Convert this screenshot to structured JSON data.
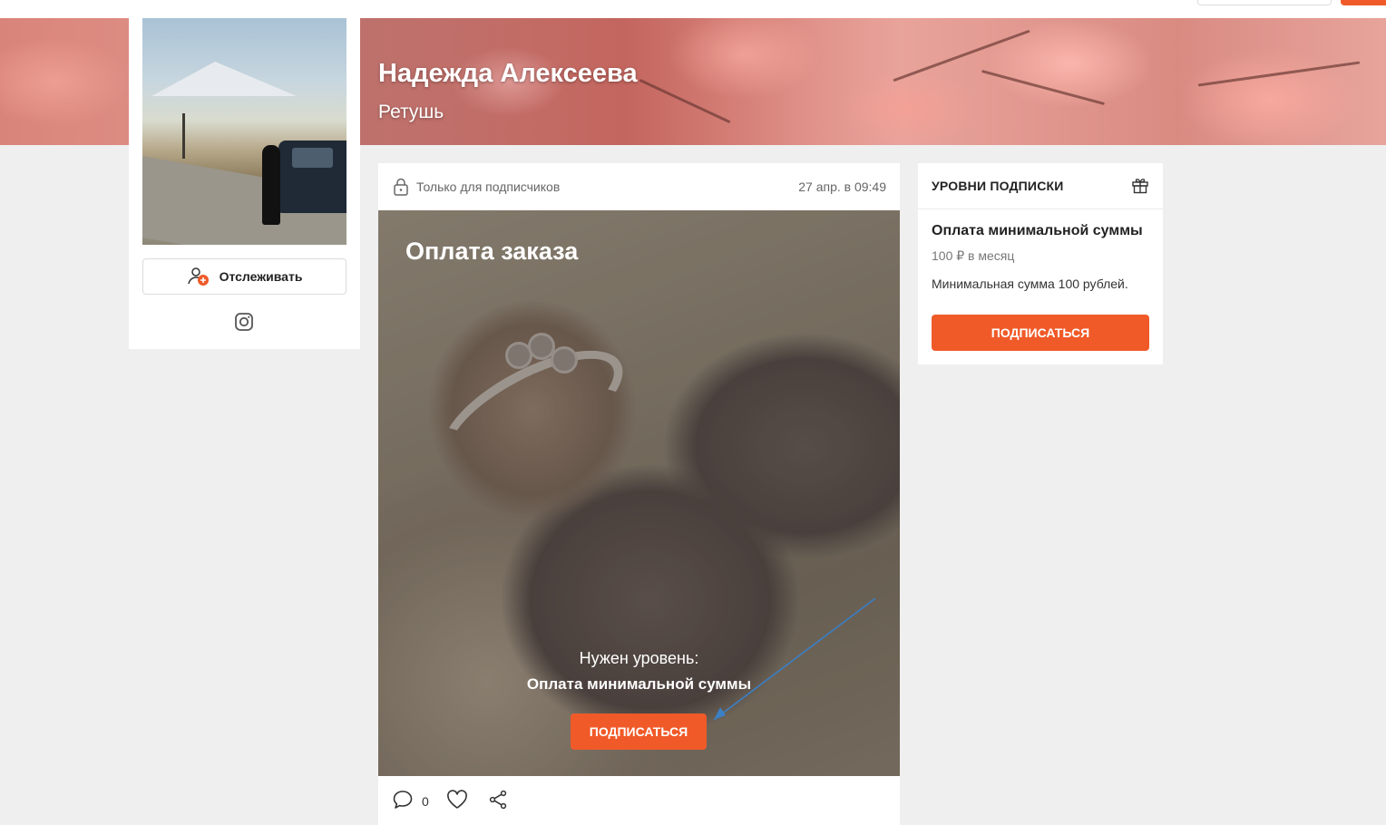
{
  "profile": {
    "name": "Надежда Алексеева",
    "subtitle": "Ретушь",
    "follow_label": "Отслеживать"
  },
  "post": {
    "access_label": "Только для подписчиков",
    "date": "27 апр. в 09:49",
    "title": "Оплата заказа",
    "need_level_label": "Нужен уровень:",
    "need_level_name": "Оплата минимальной суммы",
    "subscribe_label": "ПОДПИСАТЬСЯ",
    "comment_count": "0"
  },
  "tiers": {
    "title": "УРОВНИ ПОДПИСКИ",
    "items": [
      {
        "name": "Оплата минимальной суммы",
        "price": "100 ₽ в месяц",
        "description": "Минимальная сумма 100 рублей.",
        "button_label": "ПОДПИСАТЬСЯ"
      }
    ]
  },
  "colors": {
    "accent": "#f05a28",
    "background": "#efefef",
    "annotation_arrow": "#3b7fc4"
  },
  "icons": [
    "lock-icon",
    "follow-user-plus-icon",
    "instagram-icon",
    "gift-icon",
    "comment-icon",
    "heart-icon",
    "share-icon"
  ]
}
